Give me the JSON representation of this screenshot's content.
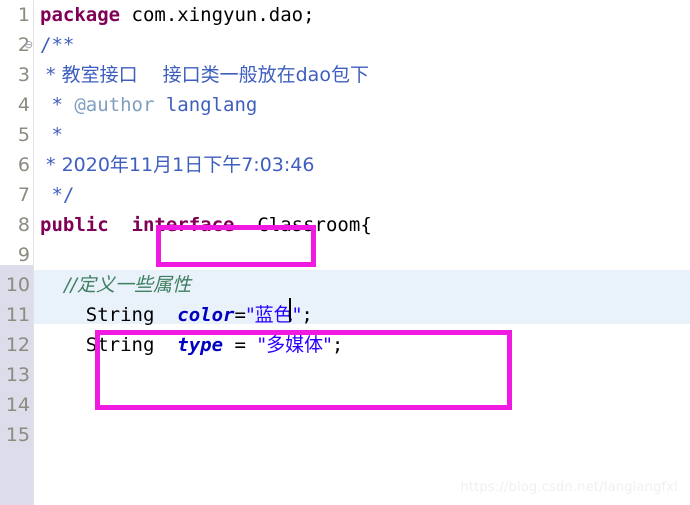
{
  "editor": {
    "language": "java",
    "current_line": 10,
    "caret": {
      "line": 10,
      "column": 11
    },
    "gutter": {
      "line_numbers": [
        "1",
        "2",
        "3",
        "4",
        "5",
        "6",
        "7",
        "8",
        "9",
        "10",
        "11",
        "12",
        "13",
        "14",
        "15"
      ],
      "fold_marker_line": "2",
      "fold_marker_glyph": "⊖"
    },
    "lines": [
      {
        "n": "1",
        "tokens": [
          {
            "t": "package",
            "c": "kw"
          },
          {
            "t": " com.xingyun.dao;",
            "c": "plain"
          }
        ]
      },
      {
        "n": "2",
        "tokens": [
          {
            "t": "/**",
            "c": "jdoc"
          }
        ]
      },
      {
        "n": "3",
        "tokens": [
          {
            "t": " * 教室接口　 接口类一般放在dao包下",
            "c": "jdoc"
          }
        ]
      },
      {
        "n": "4",
        "tokens": [
          {
            "t": " * ",
            "c": "jdoc"
          },
          {
            "t": "@author",
            "c": "jdoc-tag"
          },
          {
            "t": " langlang",
            "c": "jdoc"
          }
        ]
      },
      {
        "n": "5",
        "tokens": [
          {
            "t": " *",
            "c": "jdoc"
          }
        ]
      },
      {
        "n": "6",
        "tokens": [
          {
            "t": " * 2020年11月1日下午7:03:46",
            "c": "jdoc"
          }
        ]
      },
      {
        "n": "7",
        "tokens": [
          {
            "t": " */",
            "c": "jdoc"
          }
        ]
      },
      {
        "n": "8",
        "tokens": [
          {
            "t": "public",
            "c": "kw"
          },
          {
            "t": "  ",
            "c": "plain"
          },
          {
            "t": "interface",
            "c": "kw"
          },
          {
            "t": "  Classroom{",
            "c": "plain"
          }
        ]
      },
      {
        "n": "9",
        "tokens": []
      },
      {
        "n": "10",
        "tokens": [
          {
            "t": "    //定义一些属性",
            "c": "cmt"
          }
        ]
      },
      {
        "n": "11",
        "tokens": [
          {
            "t": "    String  ",
            "c": "plain"
          },
          {
            "t": "color",
            "c": "field"
          },
          {
            "t": "=",
            "c": "plain"
          },
          {
            "t": "\"蓝色\"",
            "c": "str"
          },
          {
            "t": ";",
            "c": "plain"
          }
        ]
      },
      {
        "n": "12",
        "tokens": [
          {
            "t": "    String  ",
            "c": "plain"
          },
          {
            "t": "type",
            "c": "field"
          },
          {
            "t": " = ",
            "c": "plain"
          },
          {
            "t": "\"多媒体\"",
            "c": "str"
          },
          {
            "t": ";",
            "c": "plain"
          }
        ]
      },
      {
        "n": "13",
        "tokens": []
      },
      {
        "n": "14",
        "tokens": []
      },
      {
        "n": "15",
        "tokens": []
      }
    ],
    "full_text": "package com.xingyun.dao;\n/**\n * 教室接口　 接口类一般放在dao包下\n * @author langlang\n *\n * 2020年11月1日下午7:03:46\n */\npublic  interface  Classroom{\n\n    //定义一些属性\n    String  color=\"蓝色\";\n    String  type = \"多媒体\";\n\n\n",
    "annotations": [
      {
        "id": "interface-keyword",
        "label": "interface",
        "color": "#f01ae0"
      },
      {
        "id": "field-declarations",
        "label": "String color / String type block",
        "color": "#f01ae0"
      }
    ],
    "colors": {
      "keyword": "#7f0055",
      "javadoc": "#3f5fbf",
      "javadoc_tag": "#7f9fbf",
      "comment": "#3f7f5f",
      "field": "#0000c0",
      "string": "#2a00ff",
      "plain": "#000000",
      "current_line_highlight": "#e9f1fb",
      "gutter_change_bar": "#dcdcea",
      "annotation": "#f01ae0",
      "background": "#ffffff"
    }
  },
  "watermark": {
    "text": "https://blog.csdn.net/langlangfxl"
  }
}
